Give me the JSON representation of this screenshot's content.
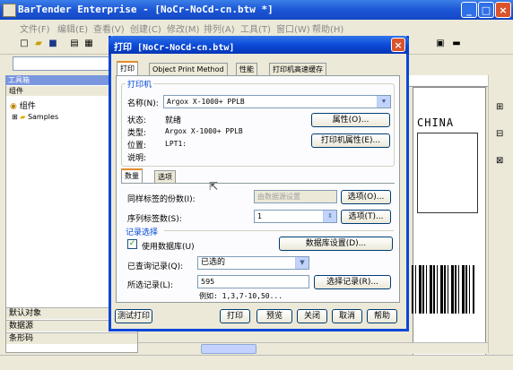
{
  "app": {
    "title": "BarTender Enterprise - [NoCr-NoCd-cn.btw *]",
    "min": "_",
    "max": "□",
    "close": "×"
  },
  "menu": [
    "文件(F)",
    "编辑(E)",
    "查看(V)",
    "创建(C)",
    "修改(M)",
    "排列(A)",
    "工具(T)",
    "窗口(W)",
    "帮助(H)"
  ],
  "left_pane": {
    "header": "工具箱",
    "subheader": "组件",
    "tree_root": "组件",
    "tree_child": "Samples",
    "bottom_bars": [
      "默认对象",
      "数据源",
      "条形码"
    ]
  },
  "canvas": {
    "label_text": "CHINA"
  },
  "dialog": {
    "title": "打印 [NoCr-NoCd-cn.btw]",
    "close": "×",
    "tabs": [
      "打印",
      "Object Print Method",
      "性能",
      "打印机高速缓存"
    ],
    "printer_group": "打印机",
    "name_label": "名称(N):",
    "name_value": "Argox X-1000+ PPLB",
    "status_label": "状态:",
    "status_value": "就绪",
    "type_label": "类型:",
    "type_value": "Argox X-1000+ PPLB",
    "location_label": "位置:",
    "location_value": "LPT1:",
    "comment_label": "说明:",
    "properties_button": "属性(O)...",
    "printer_properties_button": "打印机属性(E)...",
    "subtabs": [
      "数量",
      "选项"
    ],
    "copies_label": "同样标签的份数(I):",
    "copies_value": "由数据源设置",
    "copies_options_button": "选项(O)...",
    "serial_label": "序列标签数(S):",
    "serial_value": "1",
    "serial_options_button": "选项(T)...",
    "record_group": "记录选择",
    "use_database_label": "使用数据库(U)",
    "database_setup_button": "数据库设置(D)...",
    "query_label": "已查询记录(Q):",
    "query_value": "已选的",
    "selected_label": "所选记录(L):",
    "selected_value": "595",
    "select_records_button": "选择记录(R)...",
    "example_text": "例如:  1,3,7-10,50...",
    "test_print_button": "测试打印",
    "print_button": "打印",
    "preview_button": "预览",
    "close_button": "关闭",
    "cancel_button": "取消",
    "help_button": "帮助"
  }
}
